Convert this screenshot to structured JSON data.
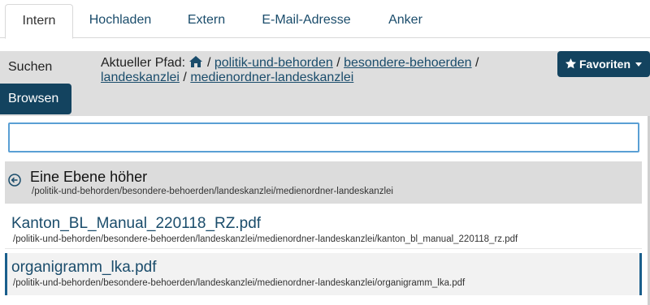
{
  "tabs": [
    {
      "label": "Intern",
      "active": true
    },
    {
      "label": "Hochladen"
    },
    {
      "label": "Extern"
    },
    {
      "label": "E-Mail-Adresse"
    },
    {
      "label": "Anker"
    }
  ],
  "sidebar": {
    "search_label": "Suchen",
    "browse_label": "Browsen"
  },
  "path": {
    "prefix": "Aktueller Pfad:",
    "home_icon": "home-icon",
    "segments": [
      "politik-und-behorden",
      "besondere-behoerden",
      "landeskanzlei",
      "medienordner-landeskanzlei"
    ],
    "separator": "/"
  },
  "favorites": {
    "label": "Favoriten",
    "icon": "star-icon"
  },
  "search": {
    "value": "",
    "placeholder": ""
  },
  "up_row": {
    "label": "Eine Ebene höher",
    "path": "/politik-und-behorden/besondere-behoerden/landeskanzlei/medienordner-landeskanzlei"
  },
  "files": [
    {
      "name": "Kanton_BL_Manual_220118_RZ.pdf",
      "path": "/politik-und-behorden/besondere-behoerden/landeskanzlei/medienordner-landeskanzlei/kanton_bl_manual_220118_rz.pdf"
    },
    {
      "name": "organigramm_lka.pdf",
      "path": "/politik-und-behorden/besondere-behoerden/landeskanzlei/medienordner-landeskanzlei/organigramm_lka.pdf",
      "hovered": true
    }
  ],
  "colors": {
    "brand": "#13435f",
    "link": "#1a4c6b",
    "input_focus": "#5a9fd4"
  }
}
